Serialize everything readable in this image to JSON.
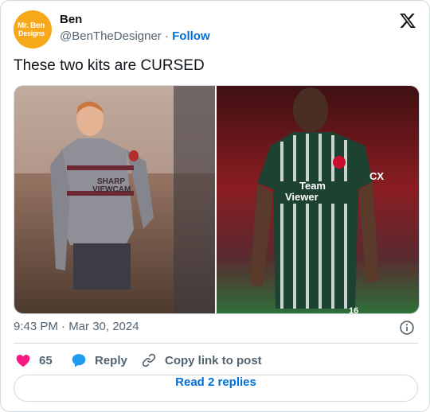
{
  "author": {
    "name": "Ben",
    "handle": "@BenTheDesigner",
    "separator": "·",
    "follow_label": "Follow",
    "avatar_text_line1": "Mr. Ben",
    "avatar_text_line2": "Designs"
  },
  "tweet": {
    "text": "These two kits are CURSED",
    "timestamp": "9:43 PM · Mar 30, 2024"
  },
  "media": {
    "left_shirt_text_line1": "SHARP",
    "left_shirt_text_line2": "VIEWCAM",
    "right_sponsor_line1": "Team",
    "right_sponsor_line2": "Viewer",
    "right_sleeve_text": "CX",
    "right_number_peek": "16"
  },
  "actions": {
    "like_count": "65",
    "reply_label": "Reply",
    "copy_label": "Copy link to post"
  },
  "footer": {
    "read_replies_label": "Read 2 replies"
  },
  "colors": {
    "link": "#006fd6",
    "like": "#f91880",
    "reply_icon": "#1d9bf0",
    "border": "#cfd9de"
  }
}
